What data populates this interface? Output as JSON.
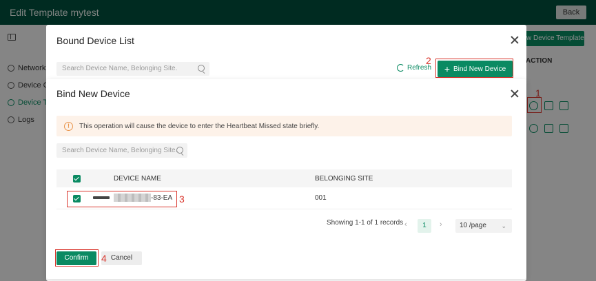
{
  "app": {
    "title": "Edit Template mytest",
    "back_label": "Back"
  },
  "sidebar": {
    "items": [
      {
        "label": "Network C",
        "icon": "globe-icon"
      },
      {
        "label": "Device Co",
        "icon": "gear-icon"
      },
      {
        "label": "Device Te",
        "icon": "template-icon",
        "active": true
      },
      {
        "label": "Logs",
        "icon": "document-icon"
      }
    ]
  },
  "background": {
    "template_button": "w Device Template",
    "action_header": "ACTION"
  },
  "bound_modal": {
    "title": "Bound Device List",
    "search_placeholder": "Search Device Name, Belonging Site.",
    "refresh_label": "Refresh",
    "bind_button": "Bind New Device"
  },
  "bind_modal": {
    "title": "Bind New Device",
    "warning": "This operation will cause the device to enter the Heartbeat Missed state briefly.",
    "search_placeholder": "Search Device Name, Belonging Site.",
    "columns": [
      "DEVICE NAME",
      "BELONGING SITE"
    ],
    "rows": [
      {
        "device_name": "-83-EA",
        "site": "001",
        "checked": true
      }
    ],
    "pagination": {
      "summary": "Showing 1-1 of 1 records",
      "current_page": "1",
      "page_size": "10 /page"
    },
    "confirm_label": "Confirm",
    "cancel_label": "Cancel"
  },
  "annotations": {
    "step1": "1",
    "step2": "2",
    "step3": "3",
    "step4": "4"
  },
  "colors": {
    "header": "#004f3d",
    "accent": "#0a8a62",
    "annotation": "#d9342b",
    "warning_bg": "#fdf2e9"
  }
}
